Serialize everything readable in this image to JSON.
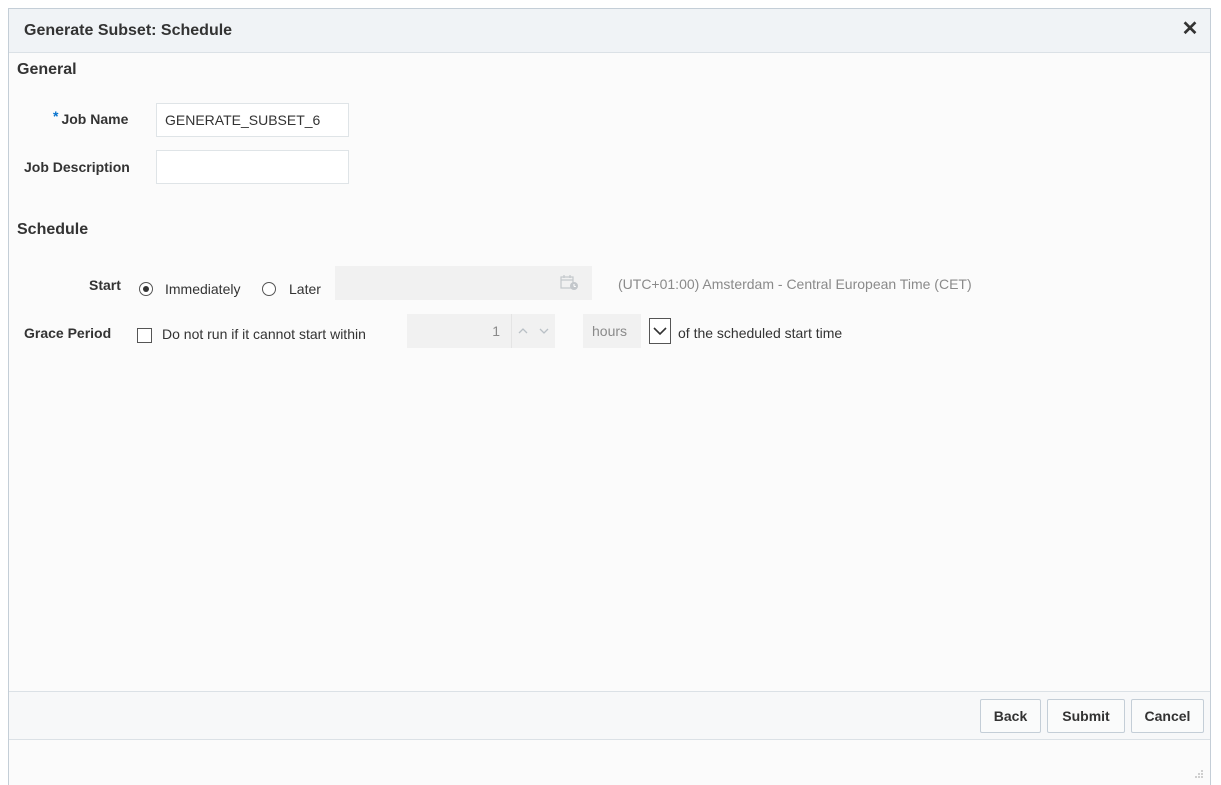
{
  "dialog": {
    "title": "Generate Subset: Schedule",
    "close_glyph": "✕"
  },
  "general": {
    "heading": "General",
    "job_name_required_mark": "*",
    "job_name_label": "Job Name",
    "job_name_value": "GENERATE_SUBSET_6",
    "job_description_label": "Job Description",
    "job_description_value": ""
  },
  "schedule": {
    "heading": "Schedule",
    "start_label": "Start",
    "start_options": [
      "Immediately",
      "Later"
    ],
    "start_selected": "Immediately",
    "later_datetime_value": "",
    "timezone_text": "(UTC+01:00) Amsterdam - Central European Time (CET)",
    "grace_period_label": "Grace Period",
    "grace_checkbox_label": "Do not run if it cannot start within",
    "grace_checked": false,
    "grace_amount": "1",
    "grace_unit": "hours",
    "grace_suffix": "of the scheduled start time"
  },
  "footer": {
    "back_label": "Back",
    "submit_label": "Submit",
    "cancel_label": "Cancel"
  },
  "icons": {
    "calendar": "calendar-icon",
    "spin_up": "chevron-up-icon",
    "spin_down": "chevron-down-icon",
    "select": "chevron-down-icon",
    "close": "close-icon",
    "resize": "resize-grip-icon"
  }
}
